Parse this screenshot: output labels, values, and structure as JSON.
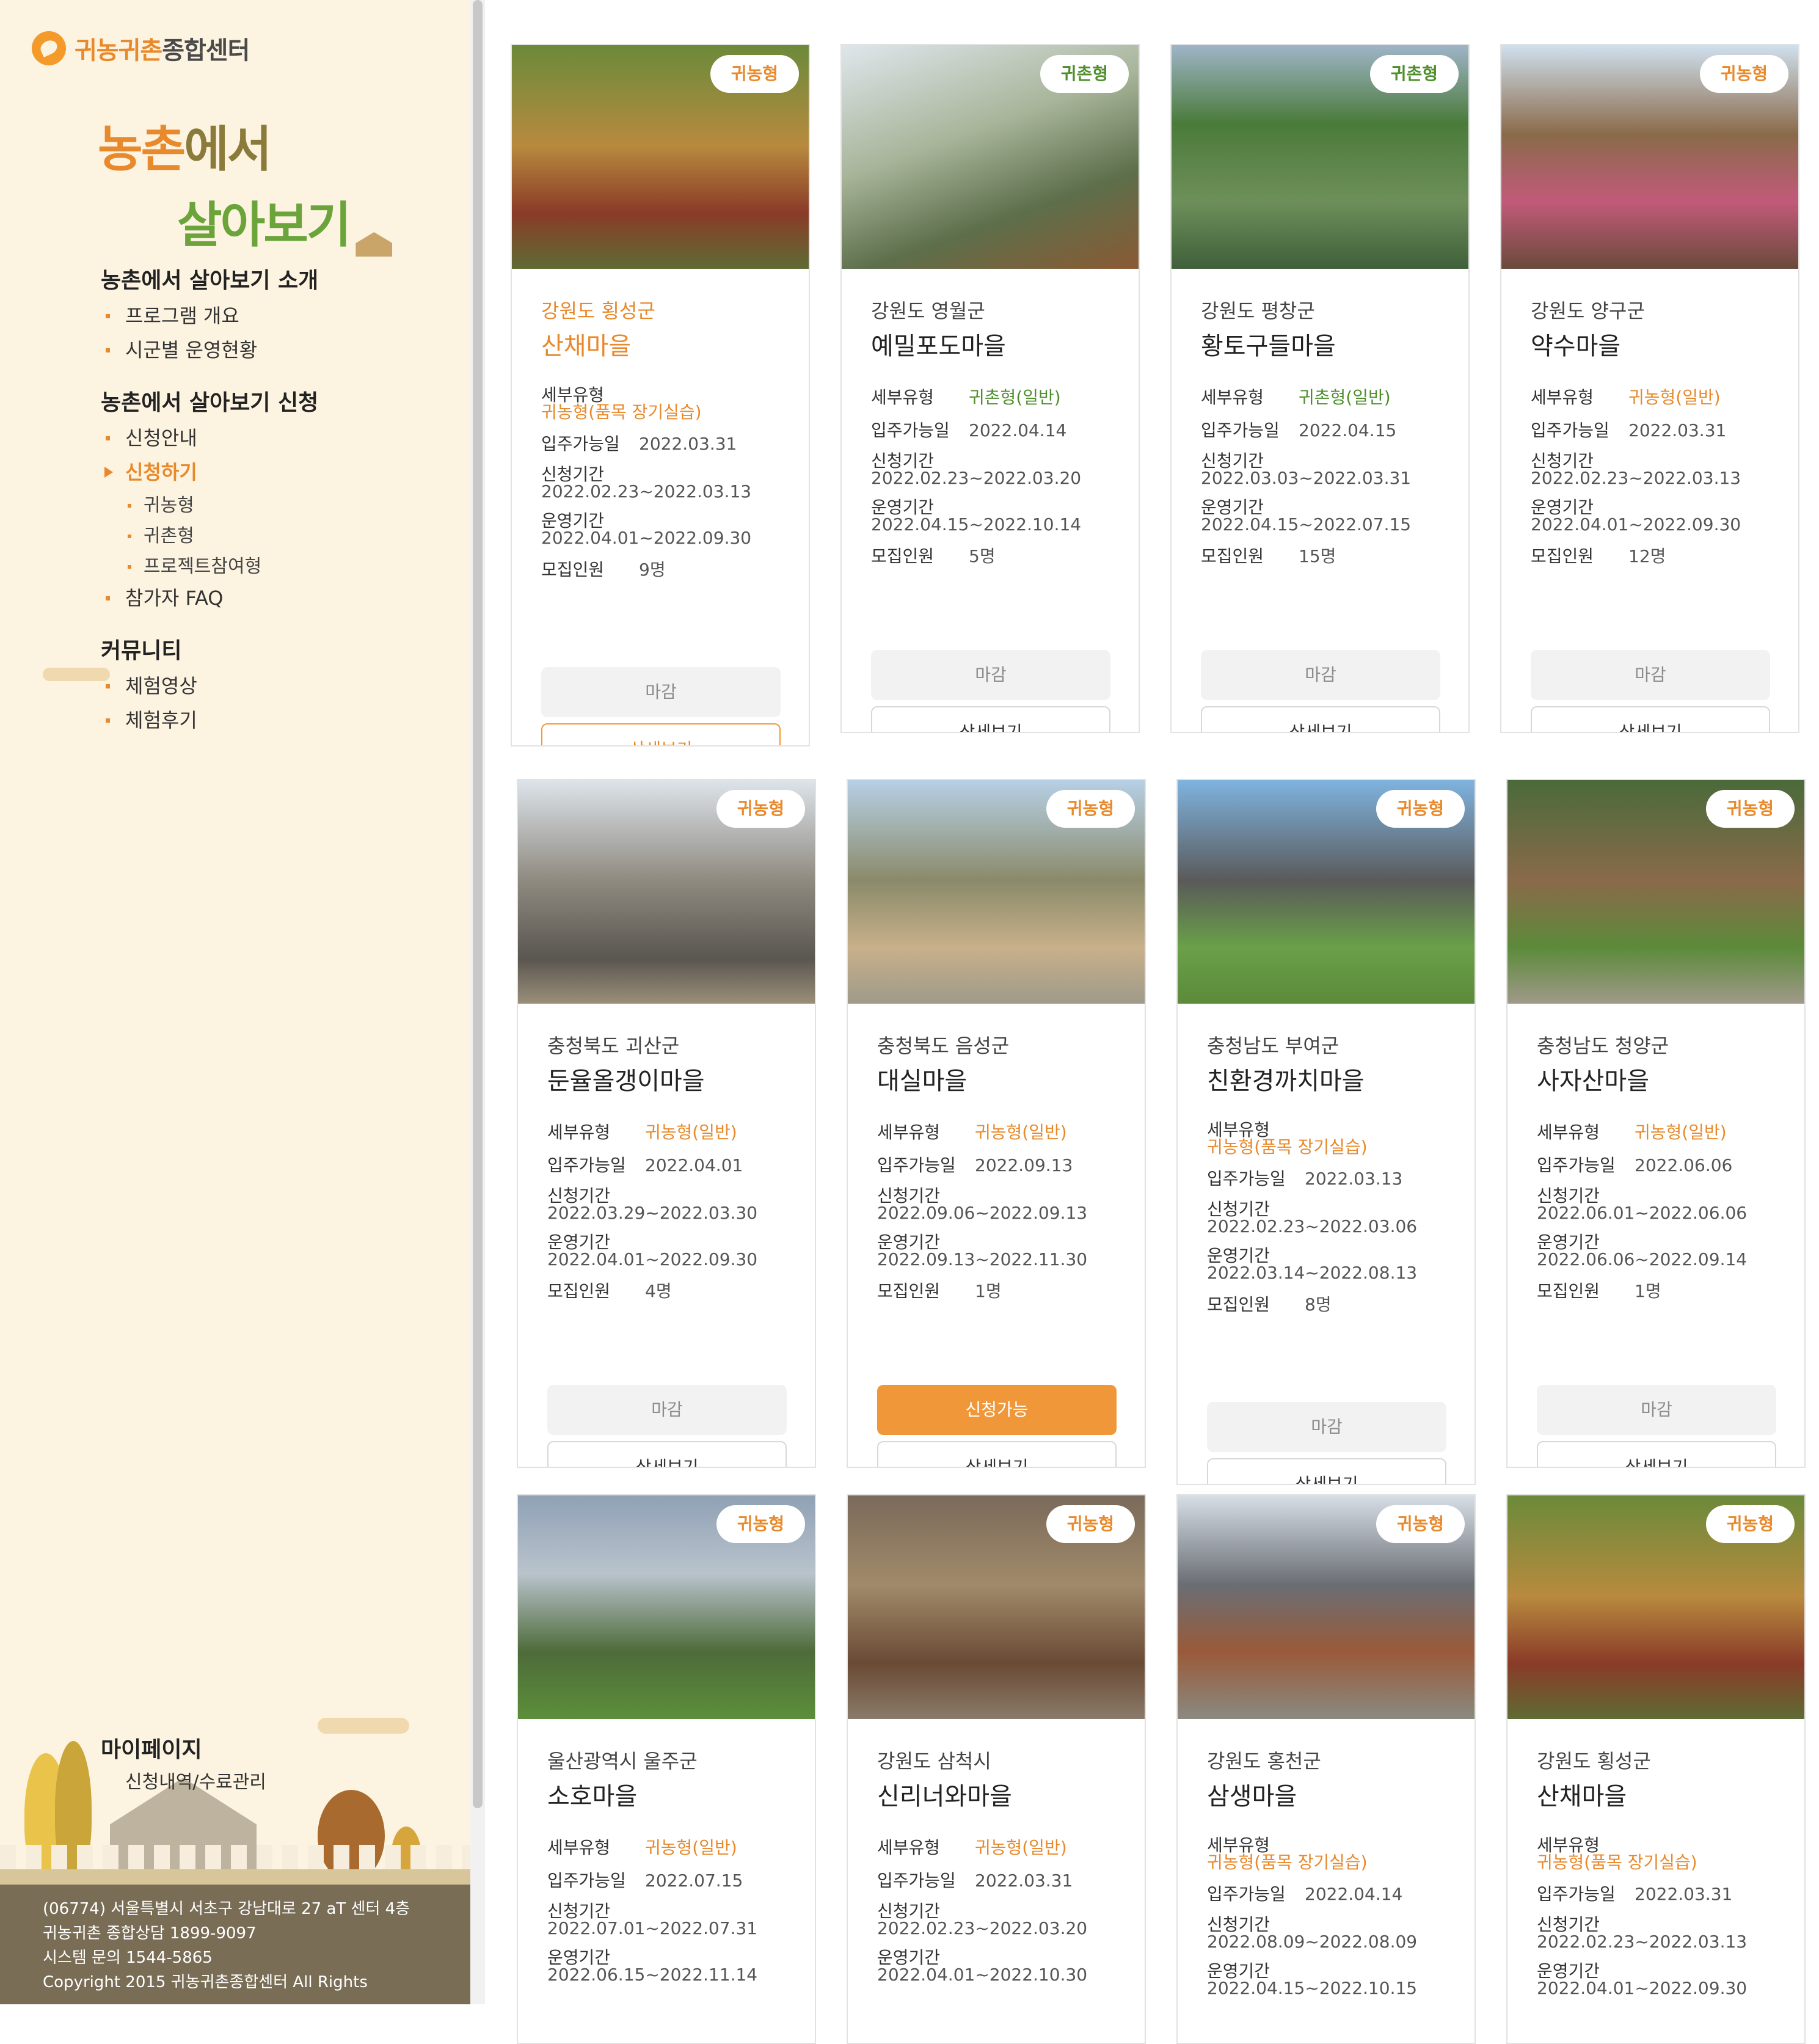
{
  "sidebar": {
    "logo": {
      "brand_colored": "귀농귀촌",
      "brand_plain": "종합센터"
    },
    "hero": {
      "line1_colored": "농촌",
      "line1_rest": "에서",
      "line2": "살아보기"
    },
    "sections": [
      {
        "title": "농촌에서 살아보기 소개",
        "items": [
          "프로그램 개요",
          "시군별 운영현황"
        ]
      },
      {
        "title": "농촌에서 살아보기 신청",
        "items": [
          "신청안내",
          "신청하기"
        ],
        "subitems": [
          "귀농형",
          "귀촌형",
          "프로젝트참여형"
        ],
        "after": "참가자 FAQ"
      },
      {
        "title": "커뮤니티",
        "items": [
          "체험영상",
          "체험후기"
        ]
      }
    ],
    "mypage": {
      "title": "마이페이지",
      "sub": "신청내역/수료관리"
    },
    "footer": [
      "(06774) 서울특별시 서초구 강남대로 27 aT 센터 4층",
      "귀농귀촌 종합상담 1899-9097",
      "시스템 문의 1544-5865",
      "Copyright 2015 귀농귀촌종합센터 All Rights"
    ]
  },
  "labels": {
    "subtype": "세부유형",
    "move_in": "입주가능일",
    "apply_period": "신청기간",
    "run_period": "운영기간",
    "recruit": "모집인원",
    "closed": "마감",
    "available": "신청가능",
    "detail": "상세보기"
  },
  "cards": [
    {
      "badge": "귀농형",
      "region": "강원도 횡성군",
      "name": "산채마을",
      "subtype": "귀농형(품목 장기실습)",
      "move_in": "2022.03.31",
      "apply": "2022.02.23~2022.03.13",
      "run": "2022.04.01~2022.09.30",
      "recruit": "9명"
    },
    {
      "badge": "귀촌형",
      "region": "강원도 영월군",
      "name": "예밀포도마을",
      "subtype": "귀촌형(일반)",
      "move_in": "2022.04.14",
      "apply": "2022.02.23~2022.03.20",
      "run": "2022.04.15~2022.10.14",
      "recruit": "5명"
    },
    {
      "badge": "귀촌형",
      "region": "강원도 평창군",
      "name": "황토구들마을",
      "subtype": "귀촌형(일반)",
      "move_in": "2022.04.15",
      "apply": "2022.03.03~2022.03.31",
      "run": "2022.04.15~2022.07.15",
      "recruit": "15명"
    },
    {
      "badge": "귀농형",
      "region": "강원도 양구군",
      "name": "약수마을",
      "subtype": "귀농형(일반)",
      "move_in": "2022.03.31",
      "apply": "2022.02.23~2022.03.13",
      "run": "2022.04.01~2022.09.30",
      "recruit": "12명"
    },
    {
      "badge": "귀농형",
      "region": "충청북도 괴산군",
      "name": "둔율올갱이마을",
      "subtype": "귀농형(일반)",
      "move_in": "2022.04.01",
      "apply": "2022.03.29~2022.03.30",
      "run": "2022.04.01~2022.09.30",
      "recruit": "4명"
    },
    {
      "badge": "귀농형",
      "region": "충청북도 음성군",
      "name": "대실마을",
      "subtype": "귀농형(일반)",
      "move_in": "2022.09.13",
      "apply": "2022.09.06~2022.09.13",
      "run": "2022.09.13~2022.11.30",
      "recruit": "1명"
    },
    {
      "badge": "귀농형",
      "region": "충청남도 부여군",
      "name": "친환경까치마을",
      "subtype": "귀농형(품목 장기실습)",
      "move_in": "2022.03.13",
      "apply": "2022.02.23~2022.03.06",
      "run": "2022.03.14~2022.08.13",
      "recruit": "8명"
    },
    {
      "badge": "귀농형",
      "region": "충청남도 청양군",
      "name": "사자산마을",
      "subtype": "귀농형(일반)",
      "move_in": "2022.06.06",
      "apply": "2022.06.01~2022.06.06",
      "run": "2022.06.06~2022.09.14",
      "recruit": "1명"
    },
    {
      "badge": "귀농형",
      "region": "울산광역시 울주군",
      "name": "소호마을",
      "subtype": "귀농형(일반)",
      "move_in": "2022.07.15",
      "apply": "2022.07.01~2022.07.31",
      "run": "2022.06.15~2022.11.14"
    },
    {
      "badge": "귀농형",
      "region": "강원도 삼척시",
      "name": "신리너와마을",
      "subtype": "귀농형(일반)",
      "move_in": "2022.03.31",
      "apply": "2022.02.23~2022.03.20",
      "run": "2022.04.01~2022.10.30"
    },
    {
      "badge": "귀농형",
      "region": "강원도 홍천군",
      "name": "삼생마을",
      "subtype": "귀농형(품목 장기실습)",
      "move_in": "2022.04.14",
      "apply": "2022.08.09~2022.08.09",
      "run": "2022.04.15~2022.10.15"
    },
    {
      "badge": "귀농형",
      "region": "강원도 횡성군",
      "name": "산채마을",
      "subtype": "귀농형(품목 장기실습)",
      "move_in": "2022.03.31",
      "apply": "2022.02.23~2022.03.13",
      "run": "2022.04.01~2022.09.30"
    }
  ],
  "colors": {
    "accent": "#e8892b",
    "green": "#4f8e2c",
    "sidebar_bg": "#fdf3e1",
    "footer_bg": "#7a6d56"
  }
}
